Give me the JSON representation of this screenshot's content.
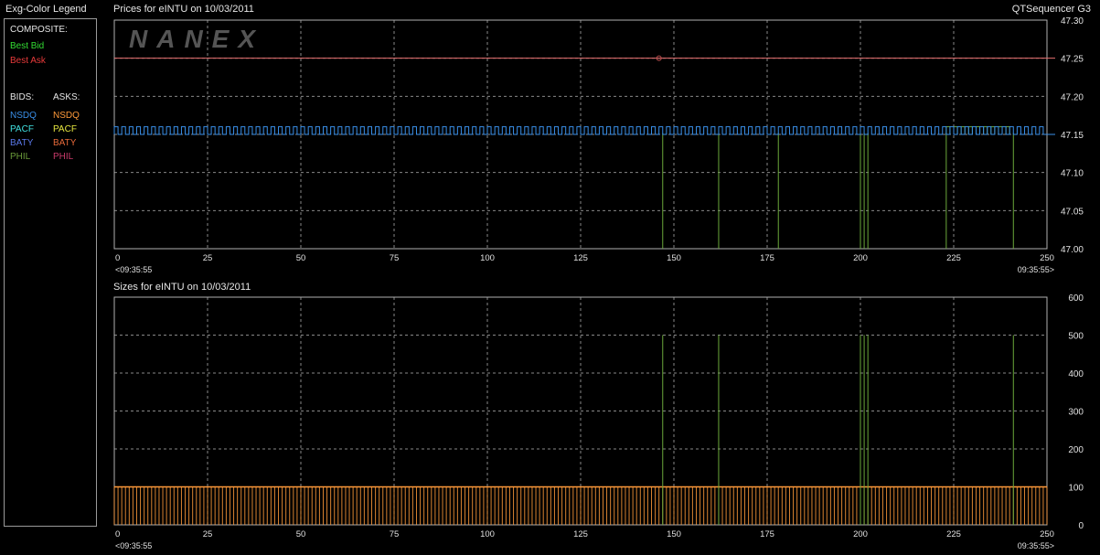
{
  "legend": {
    "title": "Exg-Color Legend",
    "composite_label": "COMPOSITE:",
    "composite": [
      {
        "label": "Best Bid",
        "color": "#33dd33"
      },
      {
        "label": "Best Ask",
        "color": "#e83a3a"
      }
    ],
    "bids_label": "BIDS:",
    "asks_label": "ASKS:",
    "bids": [
      {
        "label": "NSDQ",
        "color": "#3a8fe8"
      },
      {
        "label": "PACF",
        "color": "#40e0e0"
      },
      {
        "label": "BATY",
        "color": "#5a78e8"
      },
      {
        "label": "PHIL",
        "color": "#6a9a3a"
      }
    ],
    "asks": [
      {
        "label": "NSDQ",
        "color": "#ff9a3a"
      },
      {
        "label": "PACF",
        "color": "#e8e840"
      },
      {
        "label": "BATY",
        "color": "#e86a3a"
      },
      {
        "label": "PHIL",
        "color": "#c83a6a"
      }
    ]
  },
  "header": {
    "app_name": "QTSequencer G3",
    "watermark": "NANEX"
  },
  "chart_data": [
    {
      "type": "line",
      "title": "Prices for  eINTU  on  10/03/2011",
      "ylim": [
        47.0,
        47.3
      ],
      "yticks": [
        "47.00",
        "47.05",
        "47.10",
        "47.15",
        "47.20",
        "47.25",
        "47.30"
      ],
      "xlim": [
        0,
        250
      ],
      "xticks": [
        "0",
        "25",
        "50",
        "75",
        "100",
        "125",
        "150",
        "175",
        "200",
        "225",
        "250"
      ],
      "time_start": "<09:35:55",
      "time_end": "09:35:55>",
      "grid": true,
      "series": [
        {
          "name": "Best Ask",
          "color": "#e87070",
          "values": [
            [
              0,
              47.25
            ],
            [
              250,
              47.25
            ]
          ],
          "marker": [
            146,
            47.25
          ]
        },
        {
          "name": "NSDQ Bid",
          "color": "#3a8fe8",
          "pattern": "square-wave",
          "low": 47.15,
          "high": 47.16,
          "period": 2,
          "range": [
            0,
            250
          ]
        },
        {
          "name": "PHIL Bid",
          "color": "#6aa83a",
          "drops_to": 47.0,
          "x": [
            147,
            162,
            178,
            200,
            201,
            202,
            223,
            241
          ]
        }
      ]
    },
    {
      "type": "bar",
      "title": "Sizes for  eINTU  on  10/03/2011",
      "ylim": [
        0,
        600
      ],
      "yticks": [
        "0",
        "100",
        "200",
        "300",
        "400",
        "500",
        "600"
      ],
      "xlim": [
        0,
        250
      ],
      "xticks": [
        "0",
        "25",
        "50",
        "75",
        "100",
        "125",
        "150",
        "175",
        "200",
        "225",
        "250"
      ],
      "time_start": "<09:35:55",
      "time_end": "09:35:55>",
      "grid": true,
      "series": [
        {
          "name": "NSDQ Ask Size",
          "color": "#ff9a3a",
          "value": 100,
          "period": 2,
          "range": [
            0,
            250
          ]
        },
        {
          "name": "PHIL Bid Size",
          "color": "#6aa83a",
          "x": [
            147,
            162,
            200,
            201,
            202,
            241
          ],
          "values": [
            500,
            500,
            500,
            500,
            500,
            500
          ]
        }
      ]
    }
  ]
}
